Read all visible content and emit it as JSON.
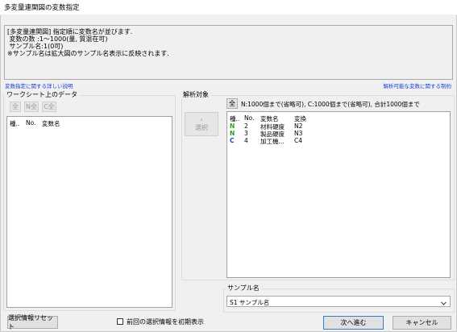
{
  "window": {
    "title": "多変量連関図の変数指定"
  },
  "info": {
    "line1": "[多変量連関図] 指定順に変数名が並びます.",
    "line2": " 変数の数 :1〜1000(量, 質混在可)",
    "line3": " サンプル名:1(0可)",
    "line4": "※サンプル名は拡大図のサンプル名表示に反映されます."
  },
  "links": {
    "left": "変数指定に関する詳しい説明",
    "right": "解析可能な変数に関する制約"
  },
  "worksheet": {
    "label": "ワークシート上のデータ",
    "buttons": {
      "all": "全",
      "n_all": "N全",
      "c_all": "C全"
    },
    "columns": [
      "種..",
      "No.",
      "変数名"
    ]
  },
  "select_button": {
    "arrow": "›",
    "label": "選択"
  },
  "analysis": {
    "label": "解析対象",
    "all_button": "全",
    "constraint": "N:1000個まで(省略可), C:1000個まで(省略可), 合計1000個まで",
    "columns": [
      "種..",
      "No.",
      "変数名",
      "変換"
    ],
    "rows": [
      {
        "type": "N",
        "no": "2",
        "name": "材料硬度",
        "conv": "N2"
      },
      {
        "type": "N",
        "no": "3",
        "name": "製品硬度",
        "conv": "N3"
      },
      {
        "type": "C",
        "no": "4",
        "name": "加工機...",
        "conv": "C4"
      }
    ]
  },
  "sample": {
    "label": "サンプル名",
    "selected": "S1 サンプル名"
  },
  "footer": {
    "reset": "選択情報リセット",
    "checkbox_label": "前回の選択情報を初期表示",
    "checkbox_checked": false,
    "next": "次へ進む",
    "cancel": "キャンセル"
  },
  "colors": {
    "type_N": "#1fa21f",
    "type_C": "#1a3fd8",
    "link": "#1a3fd8",
    "dialog_bg": "#f0f0f0"
  }
}
